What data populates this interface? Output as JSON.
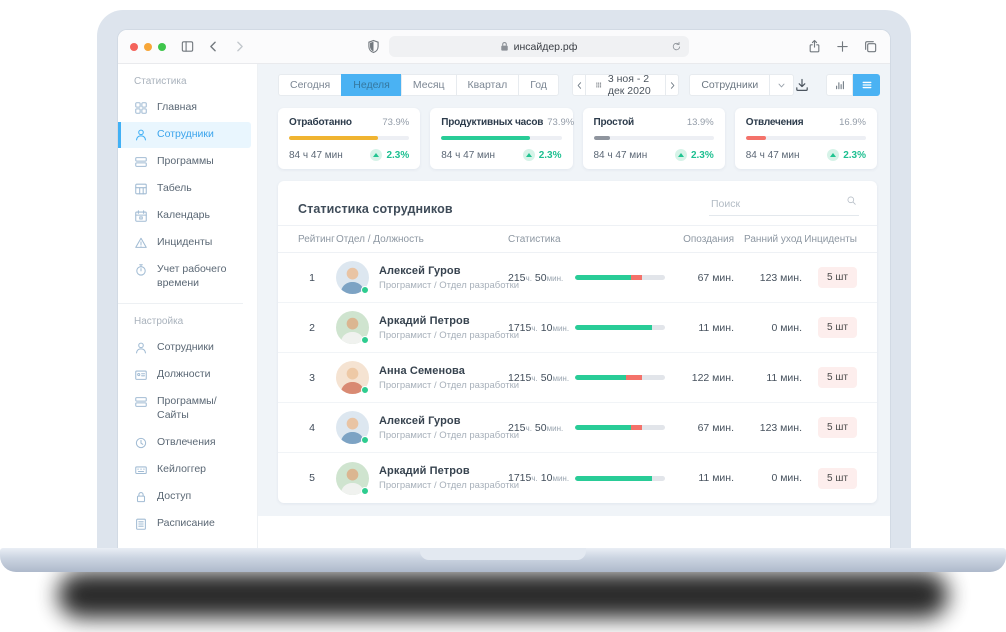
{
  "colors": {
    "accent_blue": "#4ab2f3",
    "green": "#29cc97",
    "yellow": "#f0b431",
    "red": "#f4726a",
    "gray_bar": "#8f959e",
    "badge_pink_bg": "#fdeeed",
    "traffic_red": "#f4635b",
    "traffic_yellow": "#f7a638",
    "traffic_green": "#3ec54b"
  },
  "browser": {
    "url": "инсайдер.рф",
    "icons": [
      "sidebar-toggle-icon",
      "back-icon",
      "forward-icon",
      "shield-icon",
      "lock-icon",
      "reload-icon",
      "share-icon",
      "new-tab-icon",
      "tabs-icon"
    ]
  },
  "sidebar": {
    "sections": [
      {
        "title": "Статистика",
        "items": [
          {
            "label": "Главная",
            "icon": "dashboard-icon",
            "active": false
          },
          {
            "label": "Сотрудники",
            "icon": "user-icon",
            "active": true
          },
          {
            "label": "Программы",
            "icon": "apps-icon",
            "active": false
          },
          {
            "label": "Табель",
            "icon": "table-icon",
            "active": false
          },
          {
            "label": "Календарь",
            "icon": "calendar-icon",
            "active": false
          },
          {
            "label": "Инциденты",
            "icon": "warning-icon",
            "active": false
          },
          {
            "label": "Учет рабочего времени",
            "icon": "timer-icon",
            "active": false
          }
        ]
      },
      {
        "title": "Настройка",
        "items": [
          {
            "label": "Сотрудники",
            "icon": "user-icon",
            "active": false
          },
          {
            "label": "Должности",
            "icon": "id-card-icon",
            "active": false
          },
          {
            "label": "Программы/Сайты",
            "icon": "apps-icon",
            "active": false
          },
          {
            "label": "Отвлечения",
            "icon": "clock-icon",
            "active": false
          },
          {
            "label": "Кейлоггер",
            "icon": "keyboard-icon",
            "active": false
          },
          {
            "label": "Доступ",
            "icon": "lock-icon",
            "active": false
          },
          {
            "label": "Расписание",
            "icon": "schedule-icon",
            "active": false
          }
        ]
      }
    ]
  },
  "toolbar": {
    "tabs": [
      {
        "label": "Сегодня",
        "active": false
      },
      {
        "label": "Неделя",
        "active": true
      },
      {
        "label": "Месяц",
        "active": false
      },
      {
        "label": "Квартал",
        "active": false
      },
      {
        "label": "Год",
        "active": false
      }
    ],
    "date_range": "3 ноя - 2 дек 2020",
    "scope_select": "Сотрудники"
  },
  "stat_cards": [
    {
      "title": "Отработанно",
      "percent": "73.9%",
      "bar_percent": 74,
      "bar_color": "#f0b431",
      "time": "84 ч 47 мин",
      "change": "2.3%"
    },
    {
      "title": "Продуктивных часов",
      "percent": "73.9%",
      "bar_percent": 74,
      "bar_color": "#29cc97",
      "time": "84 ч 47 мин",
      "change": "2.3%"
    },
    {
      "title": "Простой",
      "percent": "13.9%",
      "bar_percent": 14,
      "bar_color": "#8f959e",
      "time": "84 ч 47 мин",
      "change": "2.3%"
    },
    {
      "title": "Отвлечения",
      "percent": "16.9%",
      "bar_percent": 17,
      "bar_color": "#f4726a",
      "time": "84 ч 47 мин",
      "change": "2.3%"
    }
  ],
  "table": {
    "title": "Статистика сотрудников",
    "search_placeholder": "Поиск",
    "columns": [
      "Рейтинг",
      "Отдел / Должность",
      "Статистика",
      "Опоздания",
      "Ранний уход",
      "Инциденты"
    ],
    "rows": [
      {
        "rank": "1",
        "name": "Алексей Гуров",
        "role": "Програмист / Отдел разработки",
        "time_h": "215",
        "time_h_unit": "ч.",
        "time_m": "50",
        "time_m_unit": "мин.",
        "bar_green": 62,
        "bar_red": 12,
        "late": "67 мин.",
        "early": "123 мин.",
        "incidents": "5 шт",
        "avatar": {
          "bg": "#dde7f0",
          "skin": "#e9c4a4",
          "shirt": "#7da3c4"
        }
      },
      {
        "rank": "2",
        "name": "Аркадий Петров",
        "role": "Програмист / Отдел разработки",
        "time_h": "1715",
        "time_h_unit": "ч.",
        "time_m": "10",
        "time_m_unit": "мин.",
        "bar_green": 85,
        "bar_red": 0,
        "late": "11 мин.",
        "early": "0 мин.",
        "incidents": "5 шт",
        "avatar": {
          "bg": "#cfe4cf",
          "skin": "#dbb691",
          "shirt": "#f0f2ef"
        }
      },
      {
        "rank": "3",
        "name": "Анна Семенова",
        "role": "Програмист / Отдел разработки",
        "time_h": "1215",
        "time_h_unit": "ч.",
        "time_m": "50",
        "time_m_unit": "мин.",
        "bar_green": 57,
        "bar_red": 17,
        "late": "122 мин.",
        "early": "11 мин.",
        "incidents": "5 шт",
        "avatar": {
          "bg": "#f5e3d2",
          "skin": "#eec9a6",
          "shirt": "#d98a73"
        }
      },
      {
        "rank": "4",
        "name": "Алексей Гуров",
        "role": "Програмист / Отдел разработки",
        "time_h": "215",
        "time_h_unit": "ч.",
        "time_m": "50",
        "time_m_unit": "мин.",
        "bar_green": 62,
        "bar_red": 12,
        "late": "67 мин.",
        "early": "123 мин.",
        "incidents": "5 шт",
        "avatar": {
          "bg": "#dde7f0",
          "skin": "#e9c4a4",
          "shirt": "#7da3c4"
        }
      },
      {
        "rank": "5",
        "name": "Аркадий Петров",
        "role": "Програмист / Отдел разработки",
        "time_h": "1715",
        "time_h_unit": "ч.",
        "time_m": "10",
        "time_m_unit": "мин.",
        "bar_green": 85,
        "bar_red": 0,
        "late": "11 мин.",
        "early": "0 мин.",
        "incidents": "5 шт",
        "avatar": {
          "bg": "#cfe4cf",
          "skin": "#dbb691",
          "shirt": "#f0f2ef"
        }
      }
    ]
  }
}
